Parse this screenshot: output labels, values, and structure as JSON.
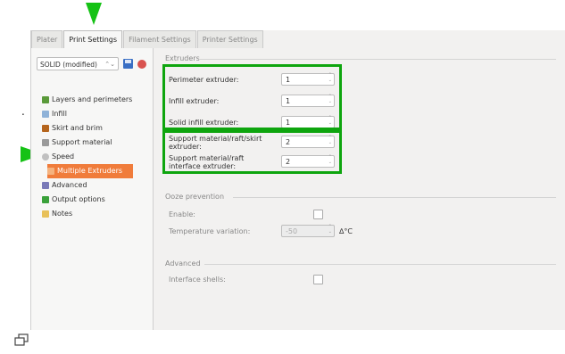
{
  "tabs": [
    "Plater",
    "Print Settings",
    "Filament Settings",
    "Printer Settings"
  ],
  "preset": {
    "value": "SOLID (modified)",
    "arrow": "⌃⌄"
  },
  "nav": [
    {
      "label": "Layers and perimeters",
      "icon": "layers-icon",
      "color": "#5a9a3a"
    },
    {
      "label": "Infill",
      "icon": "infill-icon",
      "color": "#8fb2d8"
    },
    {
      "label": "Skirt and brim",
      "icon": "skirt-icon",
      "color": "#b5651d"
    },
    {
      "label": "Support material",
      "icon": "support-icon",
      "color": "#9a9a9a"
    },
    {
      "label": "Speed",
      "icon": "speed-icon",
      "color": "#9a9a9a"
    },
    {
      "label": "Multiple Extruders",
      "icon": "extruders-icon",
      "color": "#ffffff"
    },
    {
      "label": "Advanced",
      "icon": "wrench-icon",
      "color": "#7a7ab8"
    },
    {
      "label": "Output options",
      "icon": "output-icon",
      "color": "#3aa13a"
    },
    {
      "label": "Notes",
      "icon": "notes-icon",
      "color": "#e8c15a"
    }
  ],
  "extruders": {
    "title": "Extruders",
    "perimeter_label": "Perimeter extruder:",
    "perimeter_value": "1",
    "infill_label": "Infill extruder:",
    "infill_value": "1",
    "solid_infill_label": "Solid infill extruder:",
    "solid_infill_value": "1",
    "support_label": "Support material/raft/skirt extruder:",
    "support_value": "2",
    "support_interface_label": "Support material/raft interface extruder:",
    "support_interface_value": "2"
  },
  "ooze": {
    "title": "Ooze prevention",
    "enable_label": "Enable:",
    "temp_label": "Temperature variation:",
    "temp_value": "-50",
    "temp_unit": "∆°C"
  },
  "advanced": {
    "title": "Advanced",
    "interface_shells_label": "Interface shells:"
  },
  "colors": {
    "accent": "#f07c3b",
    "highlight": "#0ea50e",
    "arrow": "#15c215"
  }
}
